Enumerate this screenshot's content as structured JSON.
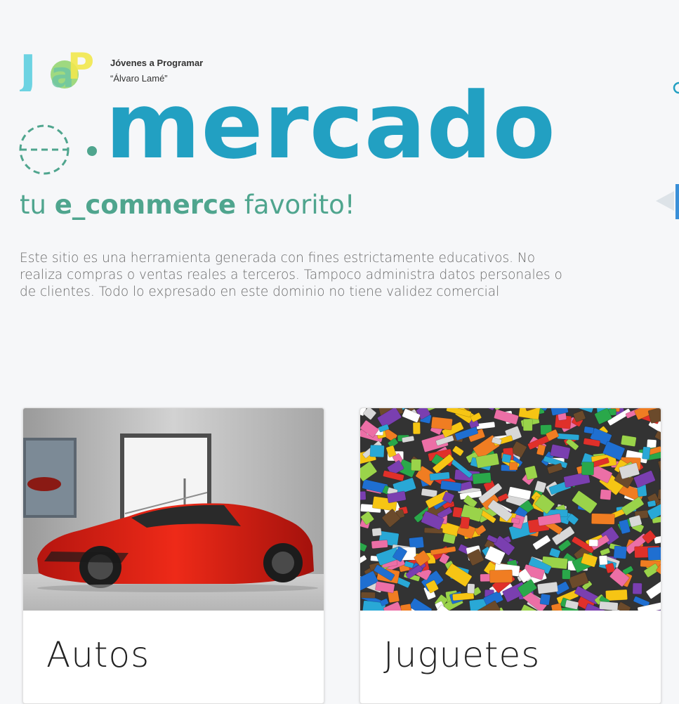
{
  "header": {
    "logo_text": "JaP",
    "org_name": "Jóvenes a Programar",
    "org_subtitle": "“Álvaro Lamé”"
  },
  "brand": {
    "word": "mercado",
    "tagline_prefix": "tu ",
    "tagline_strong": "e_commerce",
    "tagline_suffix": " favorito!",
    "icons": [
      "shopping-globe-icon",
      "search-icon"
    ]
  },
  "disclaimer": "Este sitio  es una herramienta generada con fines estrictamente educativos. No realiza compras o ventas reales a terceros. Tampoco administra datos personales o de clientes. Todo lo expresado en este dominio no tiene validez comercial",
  "categories": [
    {
      "title": "Autos",
      "image": "red-sports-car-photo"
    },
    {
      "title": "Juguetes",
      "image": "lego-bricks-photo"
    }
  ],
  "colors": {
    "brand_blue": "#22a0c2",
    "brand_green": "#4fa58e",
    "background": "#f6f7f9",
    "text_gray": "#6a6a6a"
  }
}
